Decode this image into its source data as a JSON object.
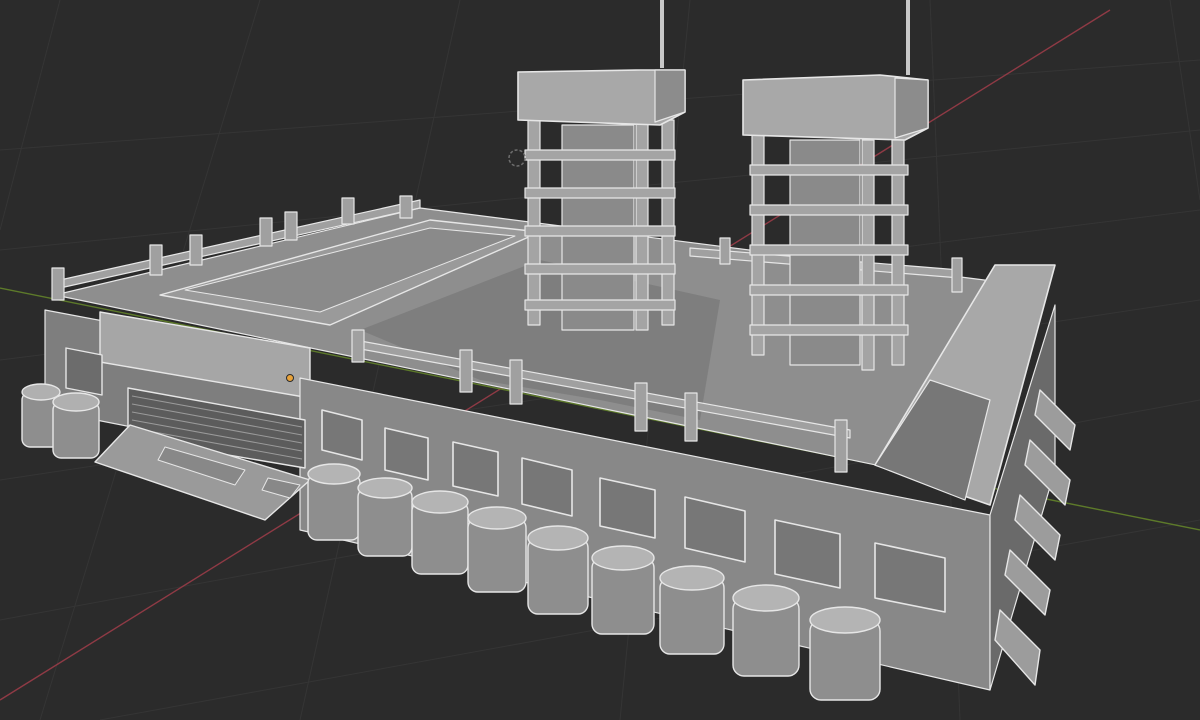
{
  "app": {
    "view": "3D Viewport",
    "shading_mode": "solid",
    "overlays": {
      "grid": true,
      "axis_x": true,
      "axis_y": true,
      "object_origin": true
    }
  },
  "scene": {
    "model": {
      "object": "industrial-rooftop-building",
      "shading": "solid-gray",
      "parts": {
        "towers": 2,
        "antennas": 2,
        "front_windows": 8,
        "front_tanks": 9,
        "corner_tanks": 2,
        "side_vents": 5,
        "garage_doors": 1,
        "ramps": 1
      }
    },
    "colors": {
      "background": "#2b2b2b",
      "grid": "#353535",
      "axis_x": "#8f3a45",
      "axis_y": "#5d7a2a",
      "model_light": "#b4b4b4",
      "model_mid": "#8c8c8c",
      "model_dark": "#5c5c5c",
      "model_edge": "#e6e6e6",
      "origin": "#e8a23a"
    }
  }
}
